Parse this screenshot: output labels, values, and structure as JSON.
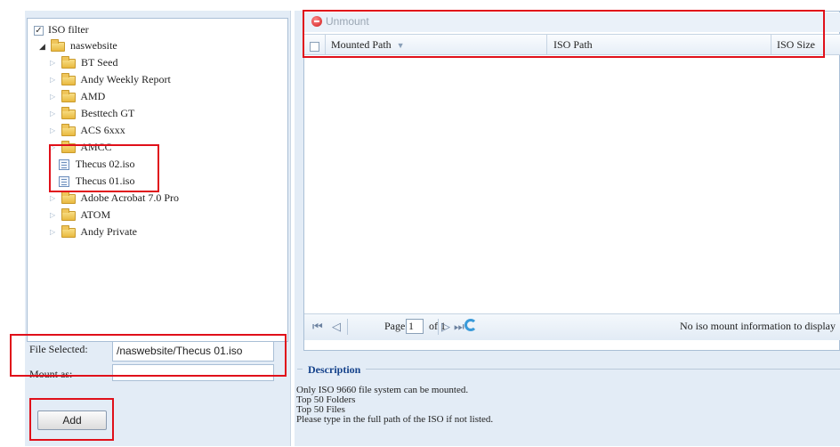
{
  "tree": {
    "filter_label": "ISO filter",
    "filter_checked": true,
    "root": "naswebsite",
    "items": [
      {
        "label": "BT Seed",
        "type": "folder"
      },
      {
        "label": "Andy Weekly Report",
        "type": "folder"
      },
      {
        "label": "AMD",
        "type": "folder"
      },
      {
        "label": "Besttech GT",
        "type": "folder"
      },
      {
        "label": "ACS 6xxx",
        "type": "folder"
      },
      {
        "label": "AMCC",
        "type": "folder"
      },
      {
        "label": "Thecus 02.iso",
        "type": "iso-file"
      },
      {
        "label": "Thecus 01.iso",
        "type": "iso-file"
      },
      {
        "label": "Adobe Acrobat 7.0 Pro",
        "type": "folder"
      },
      {
        "label": "ATOM",
        "type": "folder"
      },
      {
        "label": "Andy Private",
        "type": "folder"
      }
    ]
  },
  "form": {
    "file_selected_label": "File Selected:",
    "file_selected_value": "/naswebsite/Thecus 01.iso",
    "mount_as_label": "Mount as:",
    "mount_as_value": "",
    "add_button": "Add"
  },
  "grid": {
    "toolbar": {
      "unmount_label": "Unmount"
    },
    "columns": [
      "Mounted Path",
      "ISO Path",
      "ISO Size"
    ],
    "rows": [],
    "pager": {
      "page_label": "Page",
      "page_value": "1",
      "of_label": "of 1",
      "status": "No iso mount information to display"
    }
  },
  "description": {
    "title": "Description",
    "lines": [
      "Only ISO 9660 file system can be mounted.",
      "Top 50 Folders",
      "Top 50 Files",
      "Please type in the full path of the ISO if not listed."
    ]
  },
  "colors": {
    "highlight_border": "#e0101a",
    "panel_bg": "#e3ecf6",
    "grid_border": "#a9bfd6"
  },
  "icons": [
    "checkbox-icon",
    "collapse-arrow-icon",
    "expand-arrow-icon",
    "folder-icon",
    "iso-file-icon",
    "unmount-icon",
    "sort-arrow-icon",
    "first-page-icon",
    "prev-page-icon",
    "next-page-icon",
    "last-page-icon",
    "refresh-icon"
  ]
}
